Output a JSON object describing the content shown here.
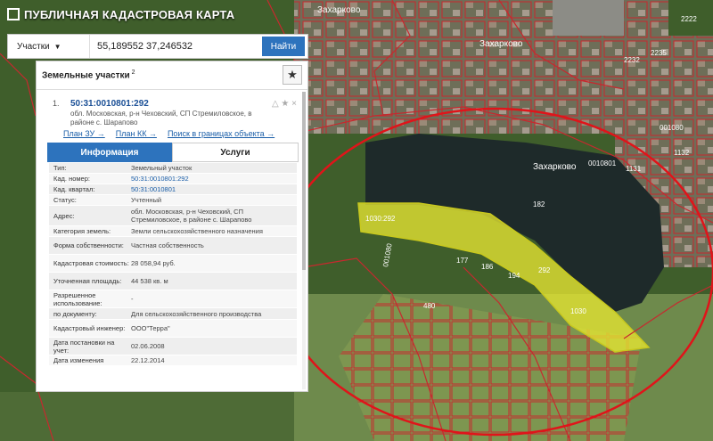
{
  "app": {
    "title": "ПУБЛИЧНАЯ КАДАСТРОВАЯ КАРТА"
  },
  "search": {
    "layer_label": "Участки",
    "query": "55,189552 37,246532",
    "button_label": "Найти"
  },
  "panel": {
    "title": "Земельные участки",
    "count": "2",
    "result": {
      "index": "1.",
      "number": "50:31:0010801:292",
      "address": "обл. Московская, р-н Чеховский, СП Стремиловское, в районе с. Шарапово"
    },
    "links": [
      "План ЗУ →",
      "План КК →",
      "Поиск в границах объекта →"
    ],
    "tabs": [
      "Информация",
      "Услуги"
    ],
    "rows": [
      {
        "label": "Тип:",
        "value": "Земельный участок",
        "link": false
      },
      {
        "label": "Кад. номер:",
        "value": "50:31:0010801:292",
        "link": true
      },
      {
        "label": "Кад. квартал:",
        "value": "50:31:0010801",
        "link": true
      },
      {
        "label": "Статус:",
        "value": "Учтенный",
        "link": false
      },
      {
        "label": "Адрес:",
        "value": "обл. Московская, р-н Чеховский, СП Стремиловское, в районе с. Шарапово",
        "link": false
      },
      {
        "label": "Категория земель:",
        "value": "Земли сельскохозяйственного назначения",
        "link": false
      },
      {
        "label": "Форма собственности:",
        "value": "Частная собственность",
        "link": false
      },
      {
        "label": "Кадастровая стоимость:",
        "value": "28 058,94 руб.",
        "link": false
      },
      {
        "label": "Уточненная площадь:",
        "value": "44 538 кв. м",
        "link": false
      },
      {
        "label": "Разрешенное использование:",
        "value": "-",
        "link": false
      },
      {
        "label": "по документу:",
        "value": "Для сельскохозяйственного производства",
        "link": false
      },
      {
        "label": "Кадастровый инженер:",
        "value": "ООО\"Терра\"",
        "link": false
      },
      {
        "label": "Дата постановки на учет:",
        "value": "02.06.2008",
        "link": false
      },
      {
        "label": "Дата изменения",
        "value": "22.12.2014",
        "link": false
      }
    ]
  },
  "map": {
    "place_labels": [
      "Захарково",
      "Захарково",
      "Захарково"
    ],
    "parcel_labels": [
      "1030:292",
      "292",
      "1030",
      "001080",
      "0010801",
      "001080",
      "1132",
      "1131",
      "177",
      "186",
      "194",
      "480",
      "182",
      "2222",
      "2232",
      "2235"
    ],
    "colors": {
      "plot": "#e6e632",
      "circle": "#e0141a",
      "border": "#c8282e",
      "water": "#1e2a2a",
      "field": "#6e8a4c"
    }
  }
}
